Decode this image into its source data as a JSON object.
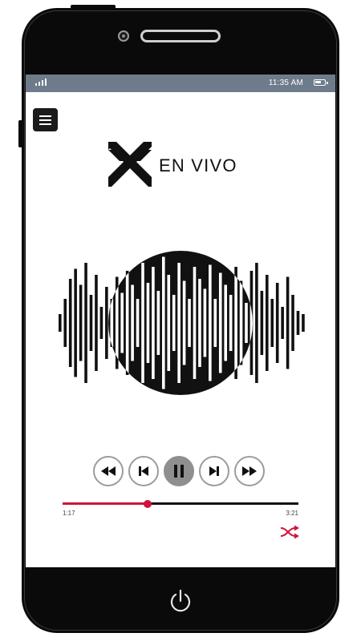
{
  "statusbar": {
    "time": "11:35 AM",
    "signal_icon": "signal-bars-icon",
    "battery_icon": "battery-icon",
    "battery_level": 0.7
  },
  "header": {
    "menu_icon": "hamburger-menu-icon"
  },
  "logo": {
    "text": "EN VIVO",
    "mark_icon": "x-logo-icon"
  },
  "visualizer": {
    "icon": "sound-wave-icon"
  },
  "controls": {
    "rewind_icon": "rewind-icon",
    "previous_icon": "skip-previous-icon",
    "play_pause_icon": "pause-icon",
    "next_icon": "skip-next-icon",
    "fast_forward_icon": "fast-forward-icon"
  },
  "player": {
    "elapsed": "1:17",
    "total": "3:21",
    "progress": 0.36
  },
  "shuffle": {
    "icon": "shuffle-icon",
    "color": "#d0133c"
  },
  "colors": {
    "accent": "#d0133c",
    "statusbar": "#6e7b8a",
    "phone_body": "#0a0a0a"
  },
  "device": {
    "power_icon": "power-icon"
  }
}
